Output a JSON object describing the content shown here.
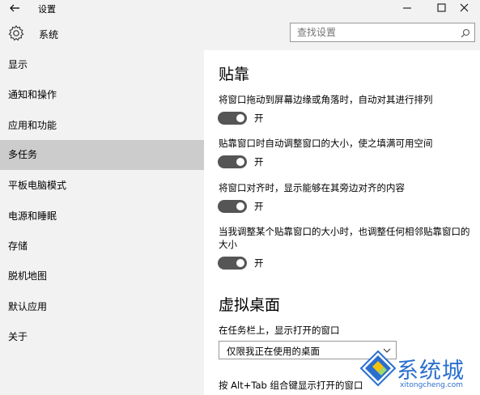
{
  "window": {
    "title": "设置"
  },
  "header": {
    "title": "系统",
    "search_placeholder": "查找设置"
  },
  "sidebar": {
    "items": [
      {
        "label": "显示"
      },
      {
        "label": "通知和操作"
      },
      {
        "label": "应用和功能"
      },
      {
        "label": "多任务",
        "active": true
      },
      {
        "label": "平板电脑模式"
      },
      {
        "label": "电源和睡眠"
      },
      {
        "label": "存储"
      },
      {
        "label": "脱机地图"
      },
      {
        "label": "默认应用"
      },
      {
        "label": "关于"
      }
    ]
  },
  "main": {
    "snap": {
      "title": "贴靠",
      "options": [
        {
          "label": "将窗口拖动到屏幕边缘或角落时，自动对其进行排列",
          "state": "开",
          "on": true
        },
        {
          "label": "贴靠窗口时自动调整窗口的大小，使之填满可用空间",
          "state": "开",
          "on": true
        },
        {
          "label": "将窗口对齐时，显示能够在其旁边对齐的内容",
          "state": "开",
          "on": true
        },
        {
          "label": "当我调整某个贴靠窗口的大小时，也调整任何相邻贴靠窗口的大小",
          "state": "开",
          "on": true
        }
      ]
    },
    "virtual_desktops": {
      "title": "虚拟桌面",
      "taskbar_label": "在任务栏上，显示打开的窗口",
      "taskbar_value": "仅限我正在使用的桌面",
      "alttab_label": "按 Alt+Tab 组合键显示打开的窗口"
    }
  },
  "watermark": {
    "name": "系统城",
    "url": "xitongcheng.com"
  },
  "colors": {
    "toggle_on": "#555555",
    "sidebar_bg": "#f2f2f2",
    "active_bg": "#cccccc",
    "watermark": "#2a6fcf"
  }
}
